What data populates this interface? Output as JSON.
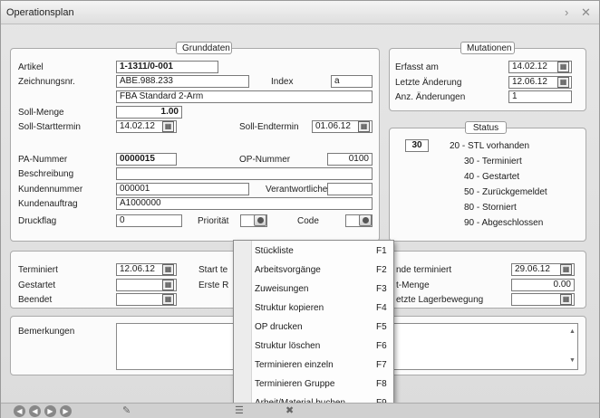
{
  "window": {
    "title": "Operationsplan"
  },
  "grunddaten": {
    "title": "Grunddaten",
    "artikel_label": "Artikel",
    "artikel": "1-1311/0-001",
    "zeichnungsnr_label": "Zeichnungsnr.",
    "zeichnungsnr": "ABE.988.233",
    "index_label": "Index",
    "index": "a",
    "bezeichnung": "FBA Standard 2-Arm",
    "soll_menge_label": "Soll-Menge",
    "soll_menge": "1.00",
    "soll_starttermin_label": "Soll-Starttermin",
    "soll_starttermin": "14.02.12",
    "soll_endtermin_label": "Soll-Endtermin",
    "soll_endtermin": "01.06.12",
    "pa_nummer_label": "PA-Nummer",
    "pa_nummer": "0000015",
    "op_nummer_label": "OP-Nummer",
    "op_nummer": "0100",
    "beschreibung_label": "Beschreibung",
    "beschreibung": "",
    "kundennummer_label": "Kundennummer",
    "kundennummer": "000001",
    "verantwortlicher_label": "Verantwortlicher",
    "verantwortlicher": "",
    "kundenauftrag_label": "Kundenauftrag",
    "kundenauftrag": "A1000000",
    "druckflag_label": "Druckflag",
    "druckflag": "0",
    "prioritaet_label": "Priorität",
    "code_label": "Code"
  },
  "mutationen": {
    "title": "Mutationen",
    "erfasst_am_label": "Erfasst am",
    "erfasst_am": "14.02.12",
    "letzte_aenderung_label": "Letzte Änderung",
    "letzte_aenderung": "12.06.12",
    "anz_aenderungen_label": "Anz. Änderungen",
    "anz_aenderungen": "1"
  },
  "status": {
    "title": "Status",
    "current": "30",
    "items": [
      "20 - STL vorhanden",
      "30 - Terminiert",
      "40 - Gestartet",
      "50 - Zurückgemeldet",
      "80 - Storniert",
      "90 - Abgeschlossen"
    ]
  },
  "termine": {
    "terminiert_label": "Terminiert",
    "terminiert": "12.06.12",
    "gestartet_label": "Gestartet",
    "beendet_label": "Beendet",
    "start_te_label": "Start te",
    "erste_r_label": "Erste R",
    "ende_terminiert_label": "nde terminiert",
    "ende_terminiert": "29.06.12",
    "menge_label": "t-Menge",
    "menge": "0.00",
    "letzte_lagerbewegung_label": "etzte Lagerbewegung"
  },
  "bemerkungen": {
    "label": "Bemerkungen"
  },
  "context_menu": {
    "items": [
      {
        "label": "Stückliste",
        "key": "F1"
      },
      {
        "label": "Arbeitsvorgänge",
        "key": "F2"
      },
      {
        "label": "Zuweisungen",
        "key": "F3"
      },
      {
        "label": "Struktur kopieren",
        "key": "F4"
      },
      {
        "label": "OP drucken",
        "key": "F5"
      },
      {
        "label": "Struktur löschen",
        "key": "F6"
      },
      {
        "label": "Terminieren einzeln",
        "key": "F7"
      },
      {
        "label": "Terminieren Gruppe",
        "key": "F8"
      },
      {
        "label": "Arbeit/Material buchen",
        "key": "F9"
      }
    ]
  }
}
